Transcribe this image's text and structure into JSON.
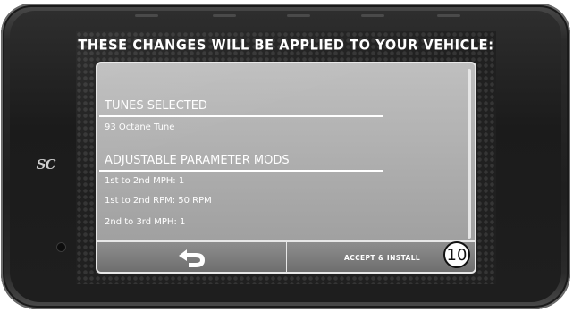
{
  "screen": {
    "title": "THESE CHANGES WILL BE APPLIED TO YOUR VEHICLE:"
  },
  "device": {
    "logo_text": "SC"
  },
  "sections": [
    {
      "heading": "TUNES SELECTED",
      "items": [
        "93 Octane Tune"
      ]
    },
    {
      "heading": "ADJUSTABLE PARAMETER MODS",
      "items": [
        "1st to 2nd MPH: 1",
        "1st to 2nd RPM: 50 RPM",
        "2nd to 3rd MPH: 1"
      ]
    }
  ],
  "footer": {
    "back_icon": "back-arrow-icon",
    "accept_label": "ACCEPT & INSTALL"
  },
  "annotation": {
    "step_number": "10"
  },
  "colors": {
    "panel_top": "#bfbfbf",
    "panel_bottom": "#9b9b9b",
    "bezel": "#1f1f1f",
    "text": "#ffffff"
  }
}
